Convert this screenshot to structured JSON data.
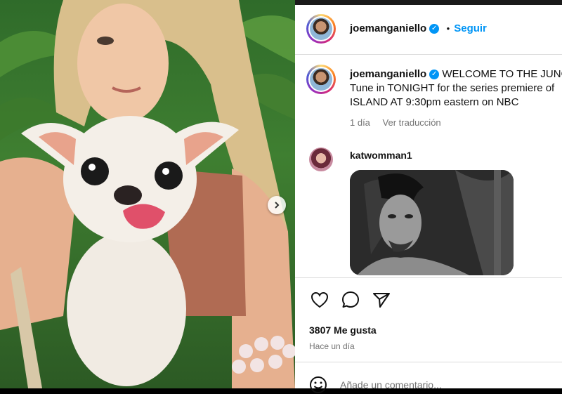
{
  "post": {
    "username": "joemanganiello",
    "verified_icon": "verified-badge-icon",
    "separator": "•",
    "follow_label": "Seguir",
    "caption_line1": "WELCOME TO THE JUNG",
    "caption_line2": "Tune in TONIGHT for the series premiere of",
    "caption_line3": "ISLAND AT 9:30pm eastern on NBC",
    "caption_time": "1 día",
    "translate_label": "Ver traducción"
  },
  "comment": {
    "username": "katwomman1"
  },
  "actions": {
    "like_icon": "heart-icon",
    "comment_icon": "comment-bubble-icon",
    "share_icon": "send-icon"
  },
  "stats": {
    "likes": "3807 Me gusta",
    "posted_ago": "Hace un día"
  },
  "composer": {
    "placeholder": "Añade un comentario...",
    "emoji_icon": "emoji-icon"
  },
  "colors": {
    "accent": "#0095f6",
    "text": "#111111",
    "secondary": "#737373",
    "border": "#dbdbdb"
  }
}
